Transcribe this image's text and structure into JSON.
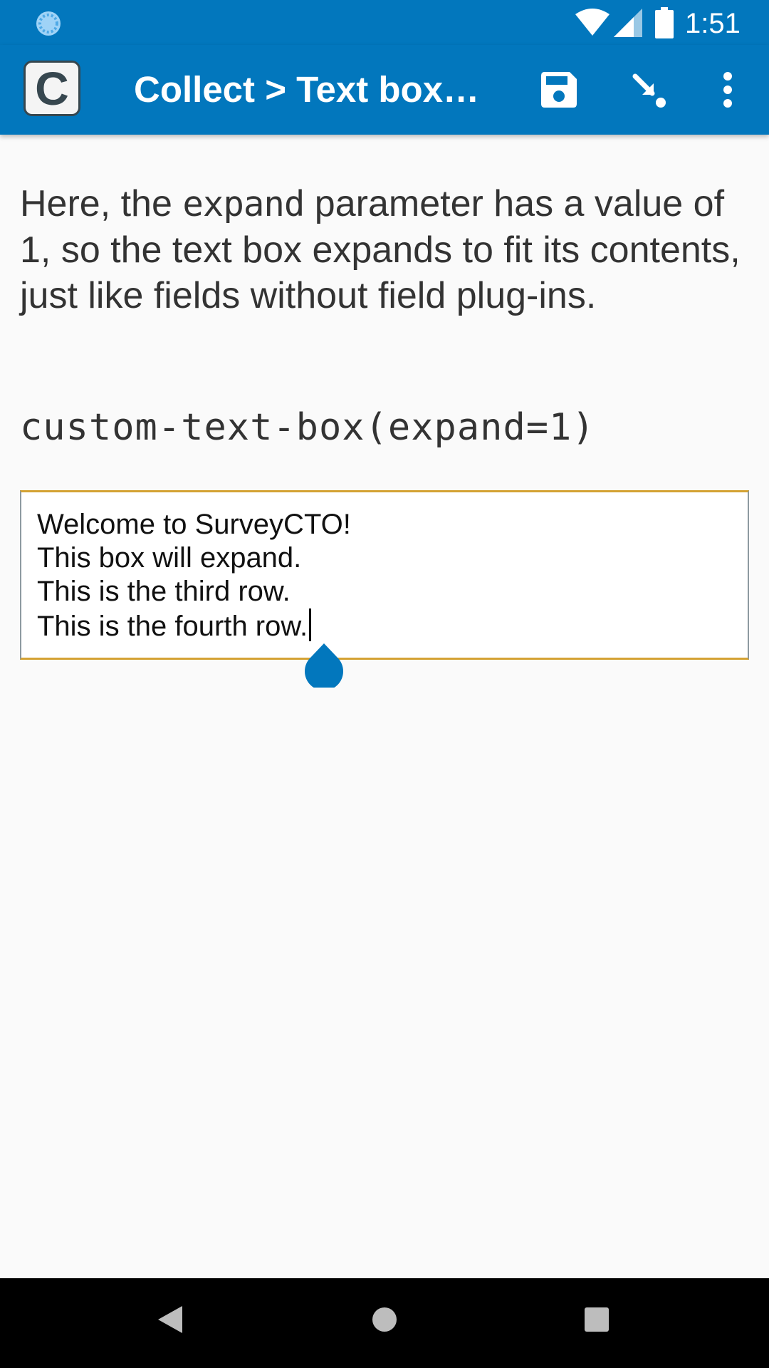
{
  "status_bar": {
    "time": "1:51",
    "icons": [
      "sync-icon",
      "wifi-icon",
      "signal-icon",
      "battery-icon"
    ]
  },
  "app_bar": {
    "logo_letter": "C",
    "title": "Collect > Text box…",
    "actions": [
      "save-icon",
      "jump-to-icon",
      "more-vert-icon"
    ]
  },
  "question": {
    "text_before": "Here, the ",
    "code_word": "expand",
    "text_after": " parameter has a value of 1, so the text box expands to fit its contents, just like fields without field plug-ins.",
    "appearance": "custom-text-box(expand=1)"
  },
  "answer": {
    "lines": [
      "Welcome to SurveyCTO!",
      "This box will expand.",
      "This is the third row.",
      "This is the fourth row."
    ]
  },
  "nav_bar": {
    "buttons": [
      "back-icon",
      "home-icon",
      "recents-icon"
    ]
  },
  "colors": {
    "primary": "#0277bd",
    "background": "#fafafa",
    "field_accent": "#d4a233"
  }
}
